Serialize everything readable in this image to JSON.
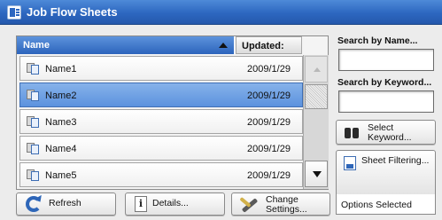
{
  "window": {
    "title": "Job Flow Sheets"
  },
  "list": {
    "columns": {
      "name": "Name",
      "updated": "Updated:"
    },
    "rows": [
      {
        "name": "Name1",
        "updated": "2009/1/29",
        "selected": false
      },
      {
        "name": "Name2",
        "updated": "2009/1/29",
        "selected": true
      },
      {
        "name": "Name3",
        "updated": "2009/1/29",
        "selected": false
      },
      {
        "name": "Name4",
        "updated": "2009/1/29",
        "selected": false
      },
      {
        "name": "Name5",
        "updated": "2009/1/29",
        "selected": false
      }
    ]
  },
  "search": {
    "by_name_label": "Search by Name...",
    "by_name_value": "",
    "by_keyword_label": "Search by Keyword...",
    "by_keyword_value": ""
  },
  "buttons": {
    "select_keyword": [
      "Select",
      "Keyword..."
    ],
    "sheet_filtering": "Sheet Filtering...",
    "options_selected": "Options Selected",
    "refresh": "Refresh",
    "details": "Details...",
    "change_settings": [
      "Change",
      "Settings..."
    ]
  },
  "icons": {
    "title": "job-flow-icon",
    "row": "document-icon",
    "select_keyword": "binoculars-icon",
    "sheet_filtering": "filter-sheet-icon",
    "refresh": "refresh-icon",
    "details": "info-icon",
    "change_settings": "wrench-icon"
  },
  "colors": {
    "title_bar": "#2d67c0",
    "selected_row": "#6a9fe2",
    "header_name": "#3a70c6"
  }
}
